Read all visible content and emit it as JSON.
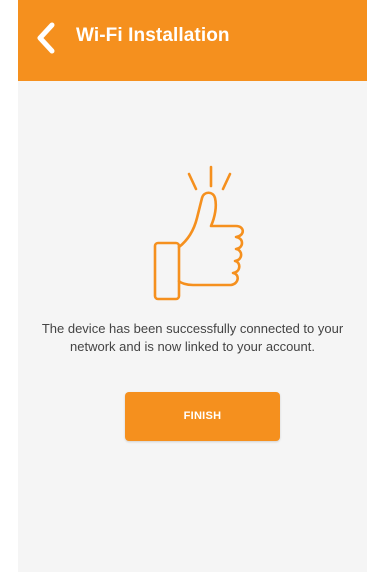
{
  "app_bar": {
    "title": "Wi-Fi Installation",
    "back_icon": "chevron-left-icon",
    "background_color": "#f5901e"
  },
  "main": {
    "hero_icon": "thumbs-up-icon",
    "message": "The device has been successfully connected to your network and is now linked to your account.",
    "finish_label": "FINISH"
  },
  "colors": {
    "accent": "#f5901e",
    "background": "#f5f5f5",
    "text": "#444444"
  }
}
